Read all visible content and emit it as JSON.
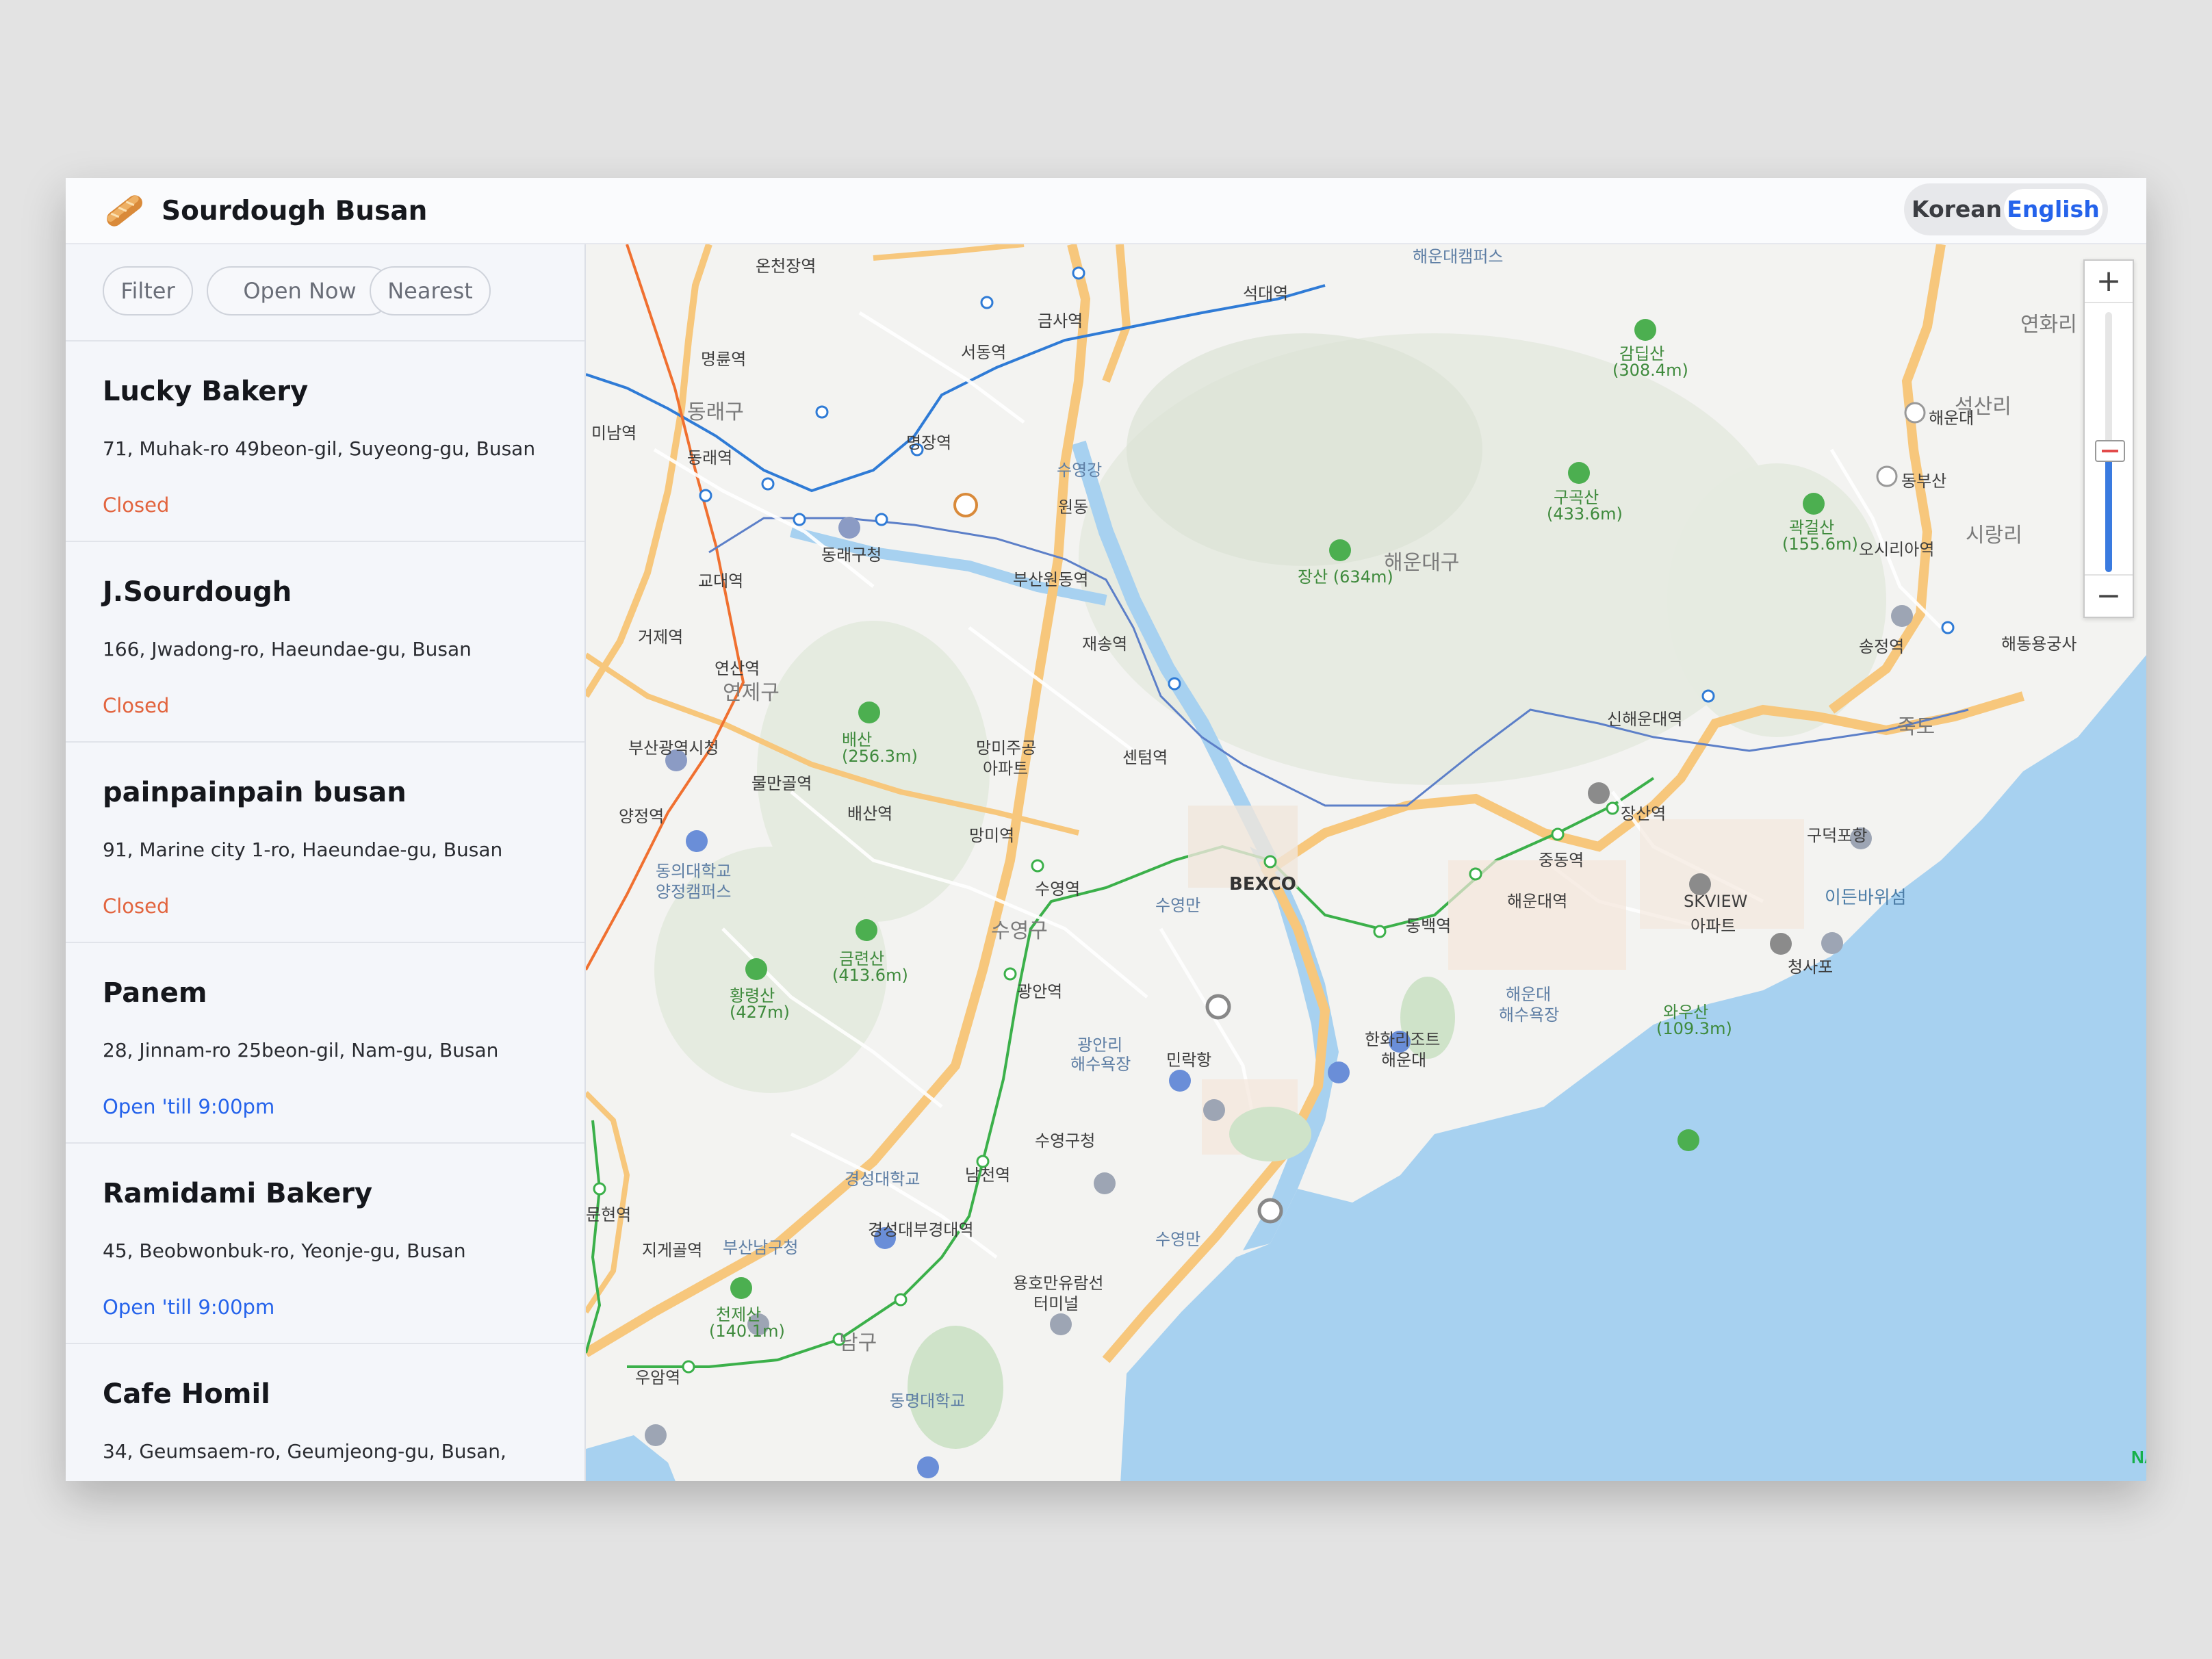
{
  "app": {
    "title": "Sourdough Busan"
  },
  "lang": {
    "korean": "Korean",
    "english": "English"
  },
  "filters": {
    "filter": "Filter",
    "open_now": "Open Now",
    "nearest": "Nearest"
  },
  "bakeries": [
    {
      "name": "Lucky Bakery",
      "address": "71, Muhak-ro 49beon-gil, Suyeong-gu, Busan",
      "status": "Closed"
    },
    {
      "name": "J.Sourdough",
      "address": "166, Jwadong-ro, Haeundae-gu, Busan",
      "status": "Closed"
    },
    {
      "name": "painpainpain busan",
      "address": "91, Marine city 1-ro, Haeundae-gu, Busan",
      "status": "Closed"
    },
    {
      "name": "Panem",
      "address": "28, Jinnam-ro 25beon-gil, Nam-gu, Busan",
      "status": "Open 'till 9:00pm"
    },
    {
      "name": "Ramidami Bakery",
      "address": "45, Beobwonbuk-ro, Yeonje-gu, Busan",
      "status": "Open 'till 9:00pm"
    },
    {
      "name": "Cafe Homil",
      "address": "34, Geumsaem-ro, Geumjeong-gu, Busan,",
      "status": ""
    }
  ],
  "map": {
    "zoom_in": "+",
    "zoom_out": "−",
    "brand": "NAVER",
    "labels": {
      "haeundae_campus": "해운대캠퍼스",
      "onchunjang": "온천장역",
      "geumsa": "금사역",
      "seokdae": "석대역",
      "myeongnyun": "명륜역",
      "seodong": "서동역",
      "dongnae_gu": "동래구",
      "dongnae_st": "동래역",
      "minam": "미남역",
      "myeongjang": "명장역",
      "suyeonggang": "수영강",
      "wondong": "원동",
      "dongnae_office": "동래구청",
      "gyodae": "교대역",
      "busanwondong": "부산원동역",
      "geoje": "거제역",
      "jaesong": "재송역",
      "yeonsan": "연산역",
      "yeonje_gu": "연제구",
      "city_hall": "부산광역시청",
      "baesan": "배산",
      "baesan_h": "(256.3m)",
      "mangmi_apt1": "망미주공",
      "mangmi_apt2": "아파트",
      "centum": "센텀역",
      "mulmangol": "물만골역",
      "baesan_st": "배산역",
      "mangmi": "망미역",
      "yangjeong": "양정역",
      "dongeui1": "동의대학교",
      "dongeui2": "양정캠퍼스",
      "suyeong_st": "수영역",
      "bexco": "BEXCO",
      "suyeongman1": "수영만",
      "suyeong_gu": "수영구",
      "geumnyeon": "금련산",
      "geumnyeon_h": "(413.6m)",
      "hwangnyeong": "황령산",
      "hwangnyeong_h": "(427m)",
      "gwangan": "광안역",
      "gwangalli1": "광안리",
      "gwangalli2": "해수욕장",
      "millak": "민락항",
      "suyeong_office": "수영구청",
      "kyungsung": "경성대학교",
      "namcheon": "남천역",
      "munhyeon": "문현역",
      "jigegol": "지게골역",
      "namgu_office": "부산남구청",
      "kyungsung_st": "경성대부경대역",
      "yongho1": "용호만유람선",
      "yongho2": "터미널",
      "suyeongman2": "수영만",
      "cheonje": "천제산",
      "cheonje_h": "(140.1m)",
      "nam_gu": "남구",
      "uam": "우암역",
      "dongmyong": "동명대학교",
      "gamdil": "감딥산",
      "gamdil_h": "(308.4m)",
      "gugok": "구곡산",
      "gugok_h": "(433.6m)",
      "jangsan": "장산 (634m)",
      "haeundae_gu": "해운대구",
      "gwakgeol": "곽걸산",
      "gwakgeol_h": "(155.6m)",
      "ic_haeundae": "해운대",
      "yeonhwa": "연화리",
      "seoksan": "석산리",
      "ic_dongbusan": "동부산",
      "osiria": "오시리아역",
      "sirang": "시랑리",
      "songjeong": "송정역",
      "haedong": "해동용궁사",
      "sinhaeundae": "신해운대역",
      "jukdo": "죽도",
      "jangsan_st": "장산역",
      "gudeok": "구덕포항",
      "jungdong": "중동역",
      "skview1": "SKVIEW",
      "skview2": "아파트",
      "haeundae_st": "해운대역",
      "dongbaek": "동백역",
      "idenbawi": "이든바위섬",
      "cheongsapo": "청사포",
      "haeundae_beach1": "해운대",
      "haeundae_beach2": "해수욕장",
      "hanwha1": "한화리조트",
      "hanwha2": "해운대",
      "wausan": "와우산",
      "wausan_h": "(109.3m)"
    }
  }
}
